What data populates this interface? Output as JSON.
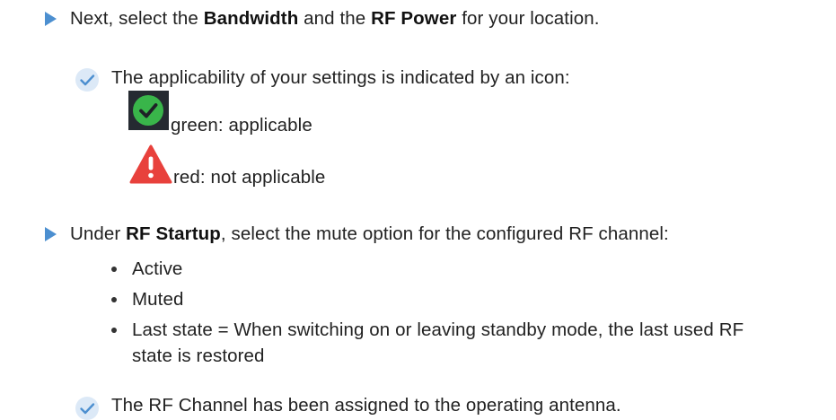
{
  "step1": {
    "prefix": "Next, select the ",
    "term1": "Bandwidth",
    "middle": " and the ",
    "term2": "RF Power",
    "suffix": " for your location."
  },
  "result1": {
    "text": "The applicability of your settings is indicated by an icon:"
  },
  "icons": {
    "green": {
      "label": "green: applicable",
      "color": "#39b54a"
    },
    "red": {
      "label": "red: not applicable",
      "color": "#e8413c"
    }
  },
  "step2": {
    "prefix": "Under ",
    "term": "RF Startup",
    "suffix": ", select the mute option for the configured RF channel:"
  },
  "options": [
    {
      "label": "Active"
    },
    {
      "label": "Muted"
    },
    {
      "label": "Last state = When switching on or leaving standby mode, the last used RF",
      "continuation": "state is restored"
    }
  ],
  "result2": {
    "text": "The RF Channel has been assigned to the operating antenna."
  },
  "colors": {
    "accent": "#4c8fd0",
    "text": "#222222"
  }
}
